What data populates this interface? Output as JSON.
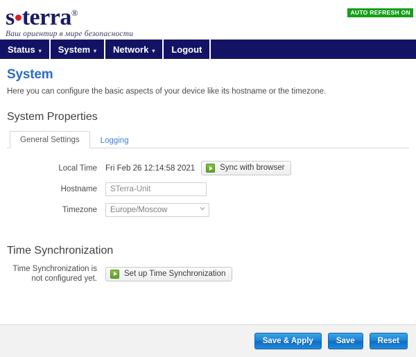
{
  "header": {
    "logo_prefix": "s",
    "logo_suffix": "terra",
    "logo_registered": "®",
    "tagline": "Ваш ориентир в мире безопасности",
    "auto_refresh_badge": "AUTO REFRESH ON",
    "auto_refresh_color": "#15a019",
    "logo_color": "#1b1b63",
    "logo_dot_color": "#e01c23"
  },
  "nav": {
    "items": [
      {
        "label": "Status",
        "caret": "▾",
        "has_caret": true
      },
      {
        "label": "System",
        "caret": "▾",
        "has_caret": true
      },
      {
        "label": "Network",
        "caret": "▾",
        "has_caret": true
      },
      {
        "label": "Logout",
        "caret": "",
        "has_caret": false
      }
    ],
    "background_color": "#131366"
  },
  "page": {
    "title": "System",
    "title_color": "#2b6cc4",
    "description": "Here you can configure the basic aspects of your device like its hostname or the timezone."
  },
  "system_properties": {
    "section_title": "System Properties",
    "tabs": [
      {
        "label": "General Settings",
        "active": true
      },
      {
        "label": "Logging",
        "active": false
      }
    ],
    "fields": {
      "local_time": {
        "label": "Local Time",
        "value": "Fri Feb 26 12:14:58 2021",
        "button_label": "Sync with browser",
        "button_icon": "play-green-icon"
      },
      "hostname": {
        "label": "Hostname",
        "value": "STerra-Unit",
        "placeholder": "STerra-Unit"
      },
      "timezone": {
        "label": "Timezone",
        "value": "Europe/Moscow",
        "caret_icon": "chevron-down-icon"
      }
    }
  },
  "time_synchronization": {
    "section_title": "Time Synchronization",
    "status_label": "Time Synchronization is not configured yet.",
    "button_label": "Set up Time Synchronization",
    "button_icon": "play-green-icon"
  },
  "footer": {
    "buttons": [
      {
        "label": "Save & Apply"
      },
      {
        "label": "Save"
      },
      {
        "label": "Reset"
      }
    ],
    "background_color": "#f2f2f2"
  }
}
